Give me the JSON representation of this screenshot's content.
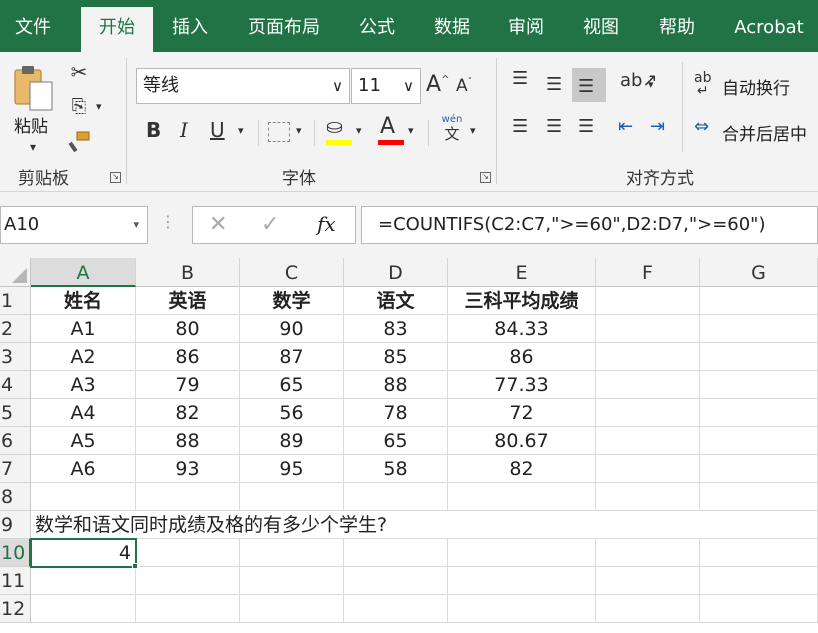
{
  "tabs": [
    "文件",
    "开始",
    "插入",
    "页面布局",
    "公式",
    "数据",
    "审阅",
    "视图",
    "帮助",
    "Acrobat"
  ],
  "active_tab": "开始",
  "ribbon": {
    "clipboard": {
      "paste_label": "粘贴",
      "group_label": "剪贴板"
    },
    "font": {
      "font_name": "等线",
      "font_size": "11",
      "bold": "B",
      "italic": "I",
      "underline": "U",
      "group_label": "字体",
      "phonetic_top": "wén",
      "phonetic_bottom": "文"
    },
    "alignment": {
      "wrap_text": "自动换行",
      "merge_center": "合并后居中",
      "group_label": "对齐方式"
    }
  },
  "formula_bar": {
    "name_box": "A10",
    "fx": "fx",
    "formula": "=COUNTIFS(C2:C7,\">=60\",D2:D7,\">=60\")"
  },
  "columns": [
    "A",
    "B",
    "C",
    "D",
    "E",
    "F",
    "G"
  ],
  "selected_column": "A",
  "rows": [
    "1",
    "2",
    "3",
    "4",
    "5",
    "6",
    "7",
    "8",
    "9",
    "10",
    "11",
    "12"
  ],
  "selected_row": "10",
  "table": {
    "headers": [
      "姓名",
      "英语",
      "数学",
      "语文",
      "三科平均成绩"
    ],
    "data": [
      [
        "A1",
        "80",
        "90",
        "83",
        "84.33"
      ],
      [
        "A2",
        "86",
        "87",
        "85",
        "86"
      ],
      [
        "A3",
        "79",
        "65",
        "88",
        "77.33"
      ],
      [
        "A4",
        "82",
        "56",
        "78",
        "72"
      ],
      [
        "A5",
        "88",
        "89",
        "65",
        "80.67"
      ],
      [
        "A6",
        "93",
        "95",
        "58",
        "82"
      ]
    ]
  },
  "question": "数学和语文同时成绩及格的有多少个学生?",
  "answer": "4",
  "colors": {
    "accent": "#217346",
    "fill_yellow": "#ffff00",
    "font_red": "#ff0000"
  }
}
